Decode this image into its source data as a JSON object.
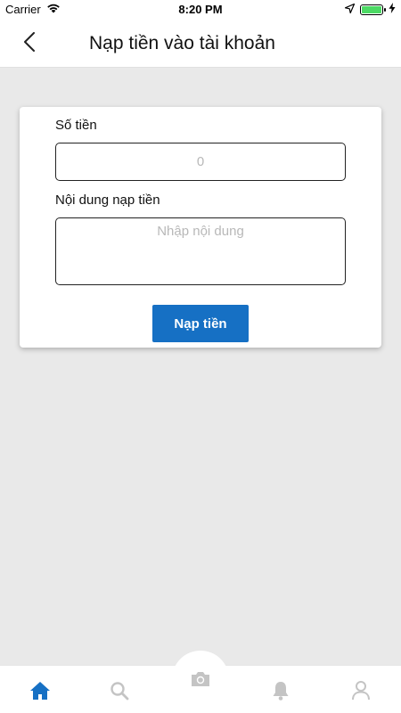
{
  "status_bar": {
    "carrier": "Carrier",
    "time": "8:20 PM"
  },
  "nav": {
    "title": "Nạp tiền vào tài khoản",
    "back_icon": "chevron-left-icon"
  },
  "form": {
    "amount_label": "Số tiền",
    "amount_placeholder": "0",
    "amount_value": "",
    "content_label": "Nội dung nạp tiền",
    "content_placeholder": "Nhập nội dung",
    "content_value": "",
    "submit_label": "Nạp tiền"
  },
  "tabs": [
    {
      "icon": "home-icon",
      "active": true
    },
    {
      "icon": "search-icon",
      "active": false
    },
    {
      "icon": "camera-icon",
      "active": false
    },
    {
      "icon": "bell-icon",
      "active": false
    },
    {
      "icon": "user-icon",
      "active": false
    }
  ],
  "colors": {
    "accent": "#1670c4",
    "inactive_icon": "#c4c4c4",
    "background": "#e9e9e9"
  }
}
